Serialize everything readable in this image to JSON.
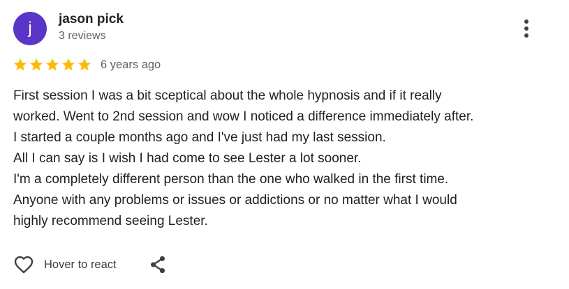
{
  "reviewer": {
    "initial": "j",
    "name": "jason pick",
    "review_count": "3 reviews",
    "avatar_color": "#5b35c8"
  },
  "rating": {
    "stars": 5,
    "max_stars": 5,
    "star_color": "#fbbc04",
    "time_ago": "6 years ago"
  },
  "review": {
    "lines": [
      "First session I was a bit sceptical about the whole hypnosis and if it really",
      "worked. Went to 2nd session and wow I noticed a difference immediately after.",
      "I started a couple months ago and I've just had my last session.",
      "All I can say is I wish I had come to see Lester a lot sooner.",
      "I'm a completely different person than the one who walked in the first time.",
      "Anyone with any problems or issues or addictions or no matter what I would",
      "highly recommend seeing Lester."
    ]
  },
  "actions": {
    "react_label": "Hover to react",
    "heart_icon": "heart-outline-icon",
    "share_icon": "share-icon",
    "more_icon": "more-vert-icon"
  }
}
